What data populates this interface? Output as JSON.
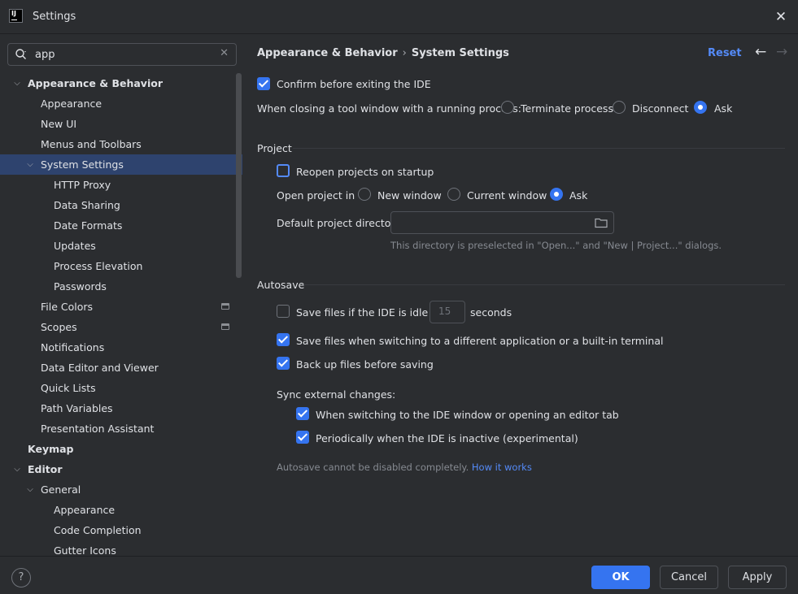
{
  "window": {
    "title": "Settings",
    "app_icon_text": "IJ"
  },
  "search": {
    "value": "app",
    "clear_glyph": "✕"
  },
  "tree": [
    {
      "label": "Appearance & Behavior",
      "level": 0,
      "bold": true,
      "expanded": true
    },
    {
      "label": "Appearance",
      "level": 1
    },
    {
      "label": "New UI",
      "level": 1
    },
    {
      "label": "Menus and Toolbars",
      "level": 1
    },
    {
      "label": "System Settings",
      "level": 1,
      "expanded": true,
      "selected": true
    },
    {
      "label": "HTTP Proxy",
      "level": 2
    },
    {
      "label": "Data Sharing",
      "level": 2
    },
    {
      "label": "Date Formats",
      "level": 2
    },
    {
      "label": "Updates",
      "level": 2
    },
    {
      "label": "Process Elevation",
      "level": 2
    },
    {
      "label": "Passwords",
      "level": 2
    },
    {
      "label": "File Colors",
      "level": 1,
      "badge": true
    },
    {
      "label": "Scopes",
      "level": 1,
      "badge": true
    },
    {
      "label": "Notifications",
      "level": 1
    },
    {
      "label": "Data Editor and Viewer",
      "level": 1
    },
    {
      "label": "Quick Lists",
      "level": 1
    },
    {
      "label": "Path Variables",
      "level": 1
    },
    {
      "label": "Presentation Assistant",
      "level": 1
    },
    {
      "label": "Keymap",
      "level": 0,
      "bold": true
    },
    {
      "label": "Editor",
      "level": 0,
      "bold": true,
      "expanded": true
    },
    {
      "label": "General",
      "level": 1,
      "expanded": true
    },
    {
      "label": "Appearance",
      "level": 2
    },
    {
      "label": "Code Completion",
      "level": 2
    },
    {
      "label": "Gutter Icons",
      "level": 2
    }
  ],
  "header": {
    "crumb_parent": "Appearance & Behavior",
    "crumb_sep": "›",
    "crumb_current": "System Settings",
    "reset": "Reset",
    "back": "←",
    "forward": "→"
  },
  "general": {
    "confirm_exit": "Confirm before exiting the IDE",
    "closing_label": "When closing a tool window with a running process:",
    "closing_options": [
      "Terminate process",
      "Disconnect",
      "Ask"
    ]
  },
  "project": {
    "title": "Project",
    "reopen": "Reopen projects on startup",
    "open_label": "Open project in",
    "open_options": [
      "New window",
      "Current window",
      "Ask"
    ],
    "dir_label": "Default project directory:",
    "dir_value": "",
    "dir_hint": "This directory is preselected in \"Open...\" and \"New | Project...\" dialogs."
  },
  "autosave": {
    "title": "Autosave",
    "idle_label": "Save files if the IDE is idle for",
    "idle_value": "15",
    "idle_unit": "seconds",
    "switching": "Save files when switching to a different application or a built-in terminal",
    "backup": "Back up files before saving",
    "sync_label": "Sync external changes:",
    "sync_switch": "When switching to the IDE window or opening an editor tab",
    "sync_periodic": "Periodically when the IDE is inactive (experimental)",
    "note": "Autosave cannot be disabled completely.",
    "note_link": "How it works"
  },
  "footer": {
    "help": "?",
    "ok": "OK",
    "cancel": "Cancel",
    "apply": "Apply"
  }
}
